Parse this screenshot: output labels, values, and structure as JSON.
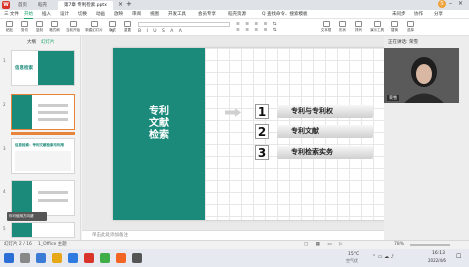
{
  "window": {
    "tabs": [
      "首页",
      "稻壳",
      "第7章 专利检索.pptx"
    ],
    "active_tab": "第7章 专利检索.pptx",
    "share_label": "分享",
    "avatar_initial": "S"
  },
  "menu": {
    "items": [
      "三 文件",
      "开始",
      "插入",
      "设计",
      "切换",
      "动画",
      "放映",
      "审阅",
      "视图",
      "开发工具",
      "会员专享",
      "稻壳资源"
    ],
    "active": "开始",
    "search_label": "Q 查找命令、搜索模板",
    "sync_label": "未同步",
    "collab_label": "协作"
  },
  "ribbon": {
    "buttons": [
      "粘贴",
      "剪切",
      "复制",
      "格式刷",
      "当前开始",
      "新建幻灯片",
      "版式",
      "节",
      "重置",
      "文本框",
      "形状",
      "排列",
      "演示工具",
      "替换",
      "选择"
    ]
  },
  "thumbs": {
    "outline_label": "大纲",
    "slides_label": "幻灯片",
    "numbers": [
      "1",
      "2",
      "3",
      "4",
      "5"
    ],
    "slide1_title": "信息检索",
    "slide3_title": "信息检索：专利文献检索与利用",
    "tooltip": "你可使用方向键"
  },
  "slide": {
    "title": "专利\n文献\n检索",
    "items": [
      {
        "num": "1",
        "text": "专利与专利权"
      },
      {
        "num": "2",
        "text": "专利文献"
      },
      {
        "num": "3",
        "text": "专利检索实务"
      }
    ]
  },
  "notes": {
    "placeholder": "单击此处添加备注"
  },
  "meeting": {
    "title": "正在讲话: 荣雪",
    "speaker_name": "荣雪"
  },
  "status": {
    "slide_info": "幻灯片 2 / 16",
    "theme": "1_Office 主题",
    "zoom": "78%"
  },
  "taskbar": {
    "temp": "15°C",
    "weather": "空气优",
    "time": "16:13",
    "date": "2022/4/6"
  },
  "colors": {
    "accent_green": "#1b8a7a",
    "selection_orange": "#e8833a",
    "wps_red": "#d9342b"
  }
}
